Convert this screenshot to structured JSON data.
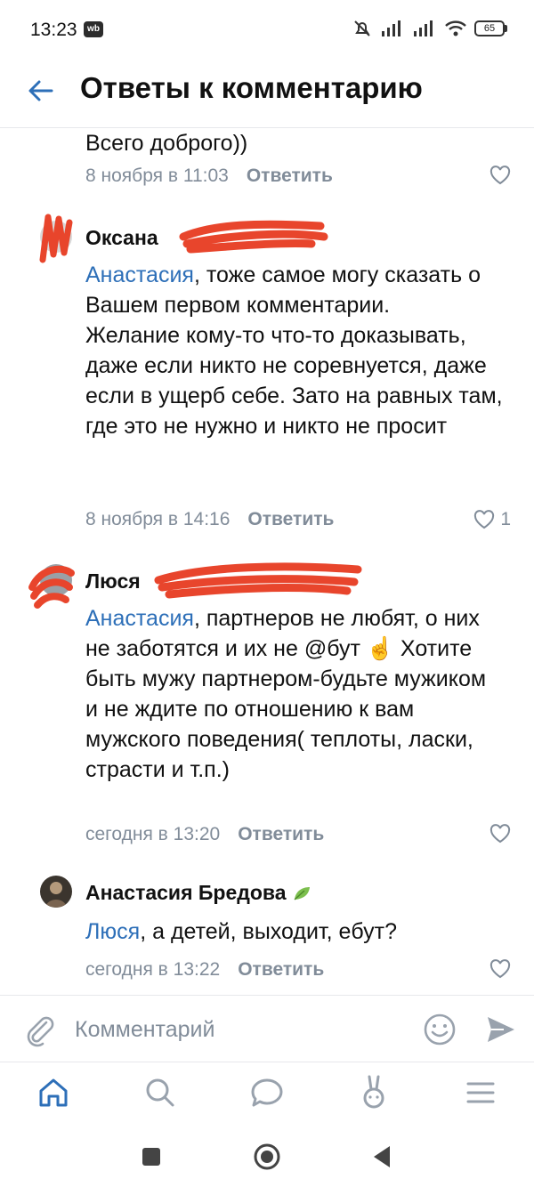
{
  "status_bar": {
    "time": "13:23",
    "app_badge": "wb",
    "battery": "65"
  },
  "header": {
    "title": "Ответы к комментарию",
    "back_icon": "arrow-left-icon"
  },
  "comments": [
    {
      "author": "",
      "text": "Всего доброго))",
      "date": "8 ноября в 11:03",
      "reply": "Ответить",
      "likes": ""
    },
    {
      "author": "Оксана",
      "mention": "Анастасия",
      "text": ", тоже самое могу сказать о Вашем первом комментарии.\nЖелание кому-то что-то доказывать, даже если никто не соревнуется, даже если в ущерб себе. Зато на равных там, где это не нужно и никто не просит",
      "date": "8 ноября в 14:16",
      "reply": "Ответить",
      "likes": "1"
    },
    {
      "author": "Люся",
      "mention": "Анастасия",
      "text": ", партнеров не любят, о них не заботятся и их не @бут ☝️ Хотите быть мужу партнером-будьте мужиком и не ждите по отношению к вам мужского поведения( теплоты, ласки, страсти и т.п.)",
      "date": "сегодня в 13:20",
      "reply": "Ответить",
      "likes": ""
    },
    {
      "author": "Анастасия Бредова",
      "mention": "Люся",
      "text": ", а детей, выходит, eбут?",
      "date": "сегодня в 13:22",
      "reply": "Ответить",
      "likes": ""
    }
  ],
  "input": {
    "placeholder": "Комментарий"
  },
  "tabs": [
    "home-icon",
    "search-icon",
    "messages-icon",
    "clips-icon",
    "menu-icon"
  ],
  "colors": {
    "accent": "#2d6fb8",
    "secondary_text": "#818c99",
    "scribble": "#e8452c"
  }
}
